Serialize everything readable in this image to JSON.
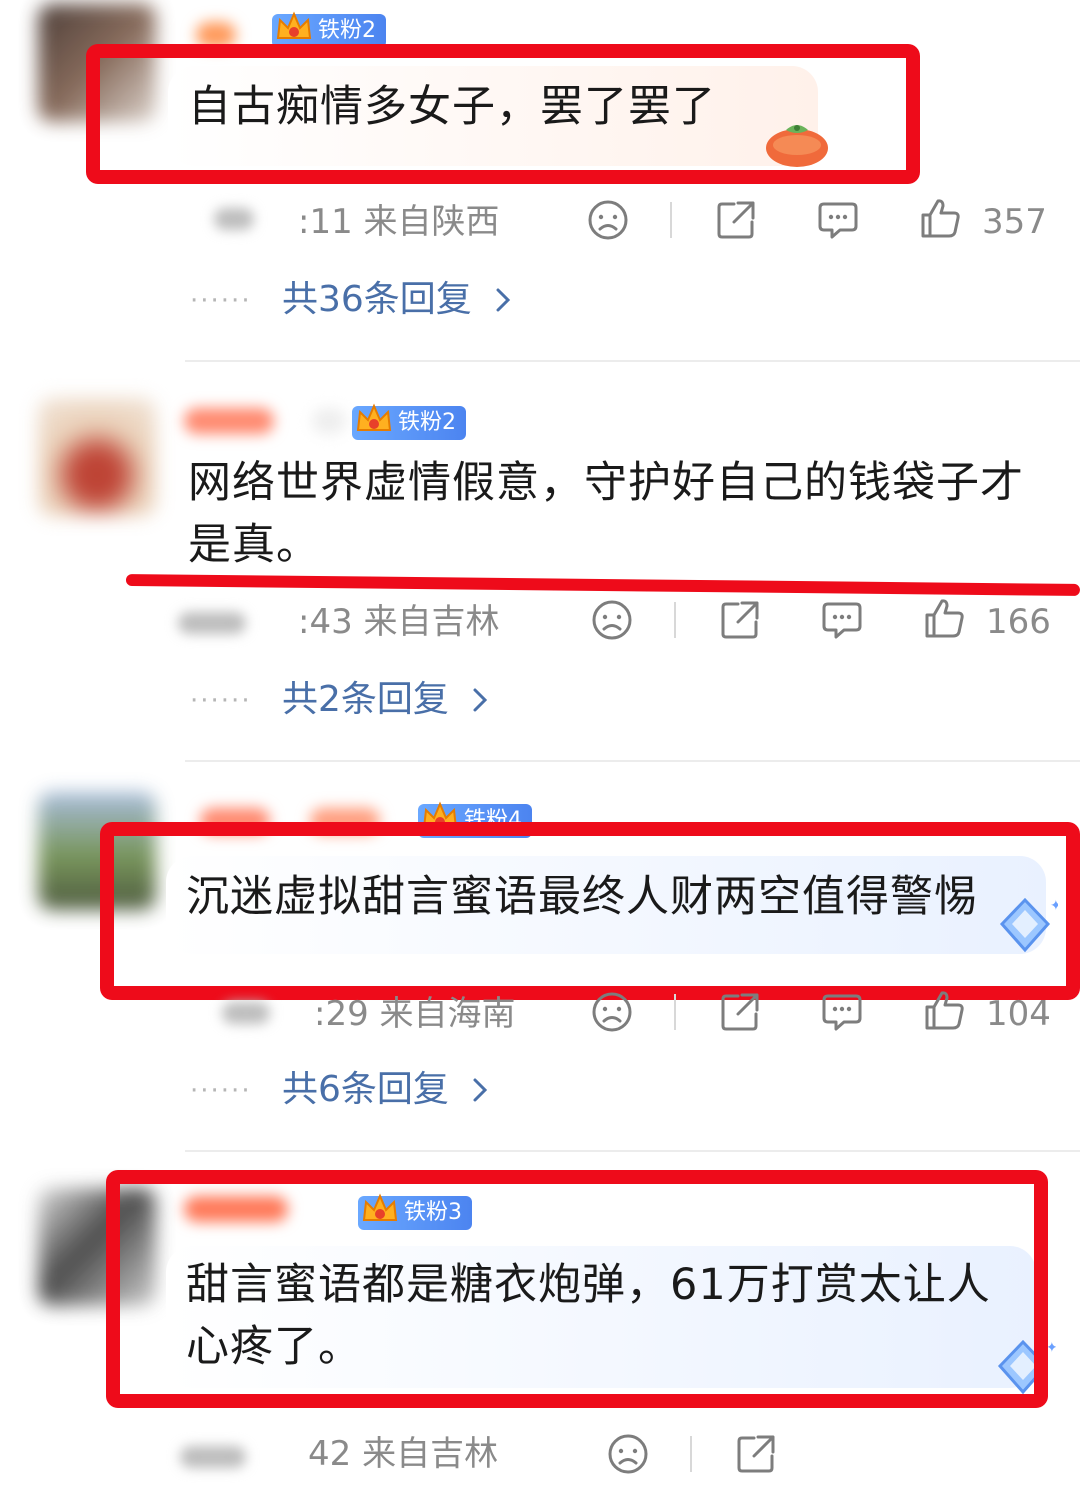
{
  "colors": {
    "highlight_red": "#ee0b1a",
    "reply_link": "#496fa8",
    "meta_grey": "#8a8a8a",
    "badge_blue": "#5b93f5"
  },
  "comments": [
    {
      "badge": "铁粉2",
      "text": "自古痴情多女子，罢了罢了",
      "time": ":11",
      "location": "来自陕西",
      "likes": "357",
      "replies": "共36条回复",
      "bubble_icon": "persimmon-icon"
    },
    {
      "badge": "铁粉2",
      "text": "网络世界虚情假意，守护好自己的钱袋子才是真。",
      "time": ":43",
      "location": "来自吉林",
      "likes": "166",
      "replies": "共2条回复"
    },
    {
      "badge": "铁粉4",
      "text": "沉迷虚拟甜言蜜语最终人财两空值得警惕",
      "time": ":29",
      "location": "来自海南",
      "likes": "104",
      "replies": "共6条回复",
      "bubble_icon": "diamond-icon"
    },
    {
      "badge": "铁粉3",
      "text": "甜言蜜语都是糖衣炮弹，61万打赏太让人心疼了。",
      "time": "42",
      "location": "来自吉林",
      "bubble_icon": "diamond-icon"
    }
  ],
  "icons": {
    "dislike": "sad-face-icon",
    "share": "share-icon",
    "comment": "comment-bubble-icon",
    "like": "thumbs-up-icon",
    "chevron": "chevron-right-icon"
  }
}
